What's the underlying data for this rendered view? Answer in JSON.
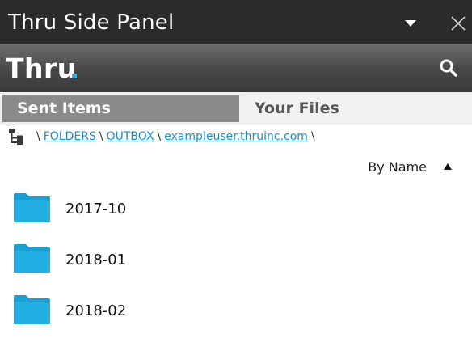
{
  "window": {
    "title": "Thru Side Panel",
    "menu_icon": "dropdown-triangle-icon",
    "close_icon": "close-icon"
  },
  "brand": {
    "logo_text": "Thru",
    "accent_color": "#3aaee0",
    "search_icon": "search-icon"
  },
  "tabs": [
    {
      "label": "Sent Items",
      "active": true
    },
    {
      "label": "Your Files",
      "active": false
    }
  ],
  "breadcrumb": {
    "icon": "folder-tree-icon",
    "separator": "\\",
    "parts": [
      "FOLDERS",
      "OUTBOX",
      "exampleuser.thruinc.com"
    ]
  },
  "sort": {
    "label": "By Name",
    "direction_icon": "sort-ascending-icon"
  },
  "folders": [
    {
      "name": "2017-10",
      "icon": "folder-icon"
    },
    {
      "name": "2018-01",
      "icon": "folder-icon"
    },
    {
      "name": "2018-02",
      "icon": "folder-icon"
    }
  ]
}
